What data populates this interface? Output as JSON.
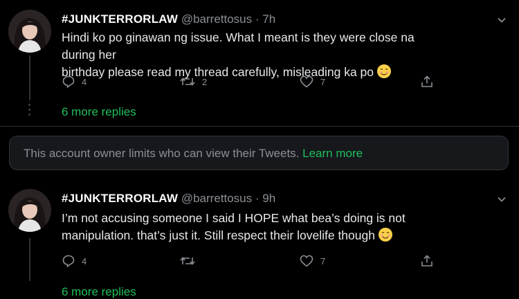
{
  "tweets": [
    {
      "display_name": "#JUNKTERRORLAW",
      "handle": "@barrettosus",
      "time": "7h",
      "line1": "Hindi ko po ginawan ng issue. What I meant is they were close na during her",
      "line2": "birthday please read my thread carefully, misleading ka po",
      "replies": "4",
      "retweets": "2",
      "likes": "7",
      "more_replies": "6 more replies"
    },
    {
      "display_name": "#JUNKTERRORLAW",
      "handle": "@barrettosus",
      "time": "9h",
      "line1": "I’m not accusing someone I said I HOPE what bea’s doing is not",
      "line2": "manipulation. that’s just it. Still respect their lovelife though",
      "replies": "4",
      "retweets": "",
      "likes": "7",
      "more_replies": "6 more replies"
    }
  ],
  "notice": {
    "text": "This account owner limits who can view their Tweets.",
    "link": "Learn more"
  },
  "colors": {
    "background": "#000000",
    "accent": "#1fbf5a",
    "muted": "#8b9096",
    "text": "#e7e9ea"
  },
  "icons": [
    "reply-icon",
    "retweet-icon",
    "like-icon",
    "share-icon",
    "chevron-down-icon",
    "smiling-face-emoji"
  ]
}
